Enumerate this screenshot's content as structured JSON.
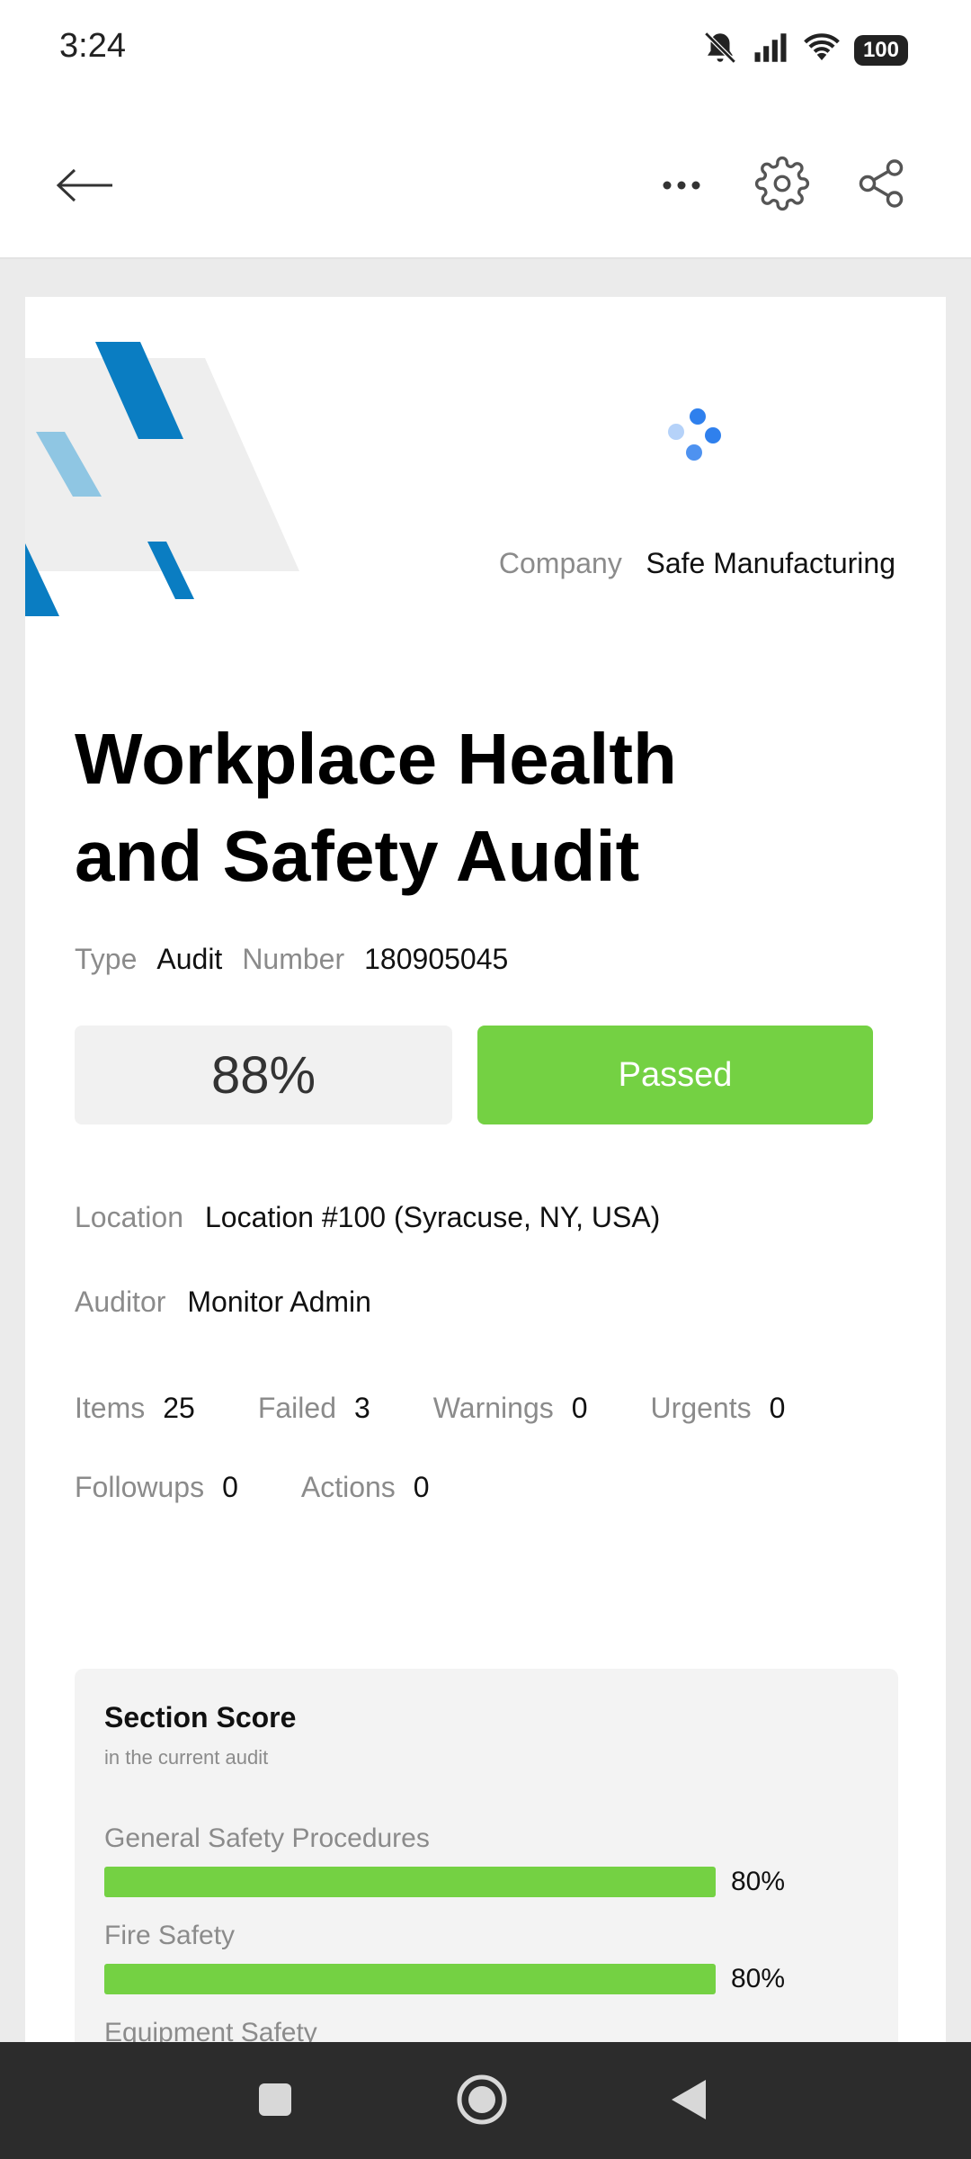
{
  "status_bar": {
    "time": "3:24",
    "battery": "100",
    "icons": [
      "notifications-off-icon",
      "signal-icon",
      "wifi-icon",
      "battery-icon"
    ]
  },
  "toolbar": {
    "back_icon": "arrow-left-icon",
    "more_icon": "more-horizontal-icon",
    "settings_icon": "gear-icon",
    "share_icon": "share-icon"
  },
  "header": {
    "company_label": "Company",
    "company_value": "Safe Manufacturing",
    "title": "Workplace Health and Safety Audit"
  },
  "meta": {
    "type_label": "Type",
    "type_value": "Audit",
    "number_label": "Number",
    "number_value": "180905045"
  },
  "result": {
    "score": "88%",
    "status": "Passed"
  },
  "details": {
    "location_label": "Location",
    "location_value": "Location #100 (Syracuse, NY, USA)",
    "auditor_label": "Auditor",
    "auditor_value": "Monitor Admin"
  },
  "stats": {
    "items_label": "Items",
    "items_value": "25",
    "failed_label": "Failed",
    "failed_value": "3",
    "warnings_label": "Warnings",
    "warnings_value": "0",
    "urgents_label": "Urgents",
    "urgents_value": "0",
    "followups_label": "Followups",
    "followups_value": "0",
    "actions_label": "Actions",
    "actions_value": "0"
  },
  "section_score": {
    "title": "Section Score",
    "subtitle": "in the current audit",
    "sections": [
      {
        "name": "General Safety Procedures",
        "percent": "80%",
        "value": 0.8
      },
      {
        "name": "Fire Safety",
        "percent": "80%",
        "value": 0.8
      },
      {
        "name": "Equipment Safety",
        "percent": "",
        "value": 0
      }
    ]
  },
  "colors": {
    "pass_green": "#74d143",
    "logo_blue": "#0a7dc2",
    "logo_light_blue": "#8fc6e3",
    "spinner_blue": "#2f80ed"
  }
}
